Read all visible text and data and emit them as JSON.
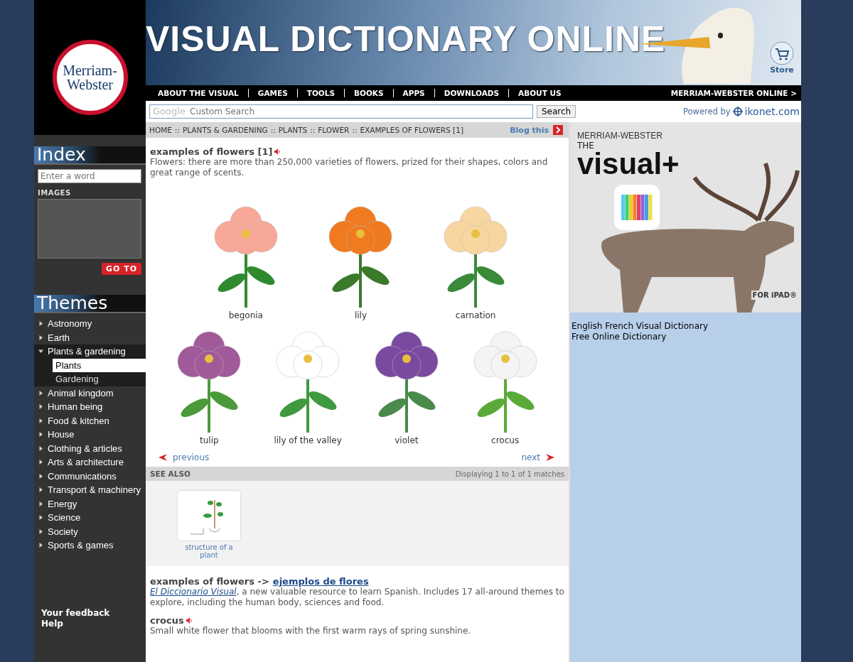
{
  "header": {
    "logo_lines": [
      "Merriam-",
      "Webster"
    ],
    "title": "VISUAL DICTIONARY ONLINE",
    "store": "Store"
  },
  "nav": {
    "items": [
      "ABOUT THE VISUAL",
      "GAMES",
      "TOOLS",
      "BOOKS",
      "APPS",
      "DOWNLOADS",
      "ABOUT US"
    ],
    "right_link": "MERRIAM-WEBSTER ONLINE >"
  },
  "search": {
    "brand": "Google",
    "placeholder": "Custom Search",
    "button": "Search",
    "powered_by": "Powered by",
    "powered_brand": "ikonet.com"
  },
  "breadcrumb": {
    "items": [
      "HOME",
      "PLANTS & GARDENING",
      "PLANTS",
      "FLOWER",
      "EXAMPLES OF FLOWERS [1]"
    ],
    "separator": "::",
    "blog": "Blog this"
  },
  "sidebar": {
    "index_title": "Index",
    "index_placeholder": "Enter a word",
    "images_label": "IMAGES",
    "go_button": "GO TO",
    "themes_title": "Themes",
    "themes": [
      {
        "label": "Astronomy",
        "expanded": false
      },
      {
        "label": "Earth",
        "expanded": false
      },
      {
        "label": "Plants & gardening",
        "expanded": true,
        "children": [
          {
            "label": "Plants",
            "selected": true
          },
          {
            "label": "Gardening",
            "selected": false
          }
        ]
      },
      {
        "label": "Animal kingdom",
        "expanded": false
      },
      {
        "label": "Human being",
        "expanded": false
      },
      {
        "label": "Food & kitchen",
        "expanded": false
      },
      {
        "label": "House",
        "expanded": false
      },
      {
        "label": "Clothing & articles",
        "expanded": false
      },
      {
        "label": "Arts & architecture",
        "expanded": false
      },
      {
        "label": "Communications",
        "expanded": false
      },
      {
        "label": "Transport & machinery",
        "expanded": false
      },
      {
        "label": "Energy",
        "expanded": false
      },
      {
        "label": "Science",
        "expanded": false
      },
      {
        "label": "Society",
        "expanded": false
      },
      {
        "label": "Sports & games",
        "expanded": false
      }
    ],
    "footer_links": [
      "Your feedback",
      "Help"
    ]
  },
  "content": {
    "title": "examples of flowers [1]",
    "description": "Flowers: there are more than 250,000 varieties of flowers, prized for their shapes, colors and great range of scents.",
    "flower_rows": [
      [
        {
          "name": "begonia"
        },
        {
          "name": "lily"
        },
        {
          "name": "carnation"
        }
      ],
      [
        {
          "name": "tulip"
        },
        {
          "name": "lily of the valley"
        },
        {
          "name": "violet"
        },
        {
          "name": "crocus"
        }
      ]
    ],
    "previous": "previous",
    "next": "next",
    "see_also": {
      "heading": "SEE ALSO",
      "matches": "Displaying 1 to 1 of 1 matches",
      "items": [
        {
          "label": "structure of a plant"
        }
      ]
    },
    "translation": {
      "term": "examples of flowers ->",
      "link": "ejemplos de flores",
      "source_link": "El Diccionario Visual",
      "text": ", a new valuable resource to learn Spanish. Includes 17 all-around themes to explore, including the human body, sciences and food."
    },
    "next_entry": {
      "title": "crocus",
      "text": "Small white flower that blooms with the first warm rays of spring sunshine."
    }
  },
  "ad": {
    "brand": "MERRIAM-WEBSTER",
    "the": "THE",
    "product": "visual+",
    "platform": "FOR iPAD®",
    "links": [
      "English French Visual Dictionary",
      "Free Online Dictionary"
    ]
  }
}
